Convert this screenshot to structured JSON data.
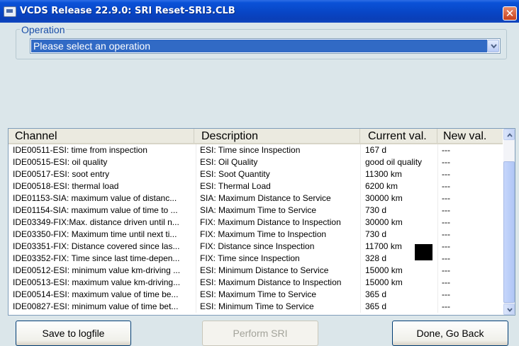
{
  "window": {
    "title": "VCDS Release 22.9.0:  SRI Reset-SRI3.CLB",
    "close_glyph": "✕"
  },
  "operation": {
    "label": "Operation",
    "selected": "Please select an operation"
  },
  "table": {
    "columns": [
      "Channel",
      "Description",
      "Current val.",
      "New val."
    ],
    "rows": [
      [
        "IDE00511-ESI: time from inspection",
        "ESI: Time since Inspection",
        "167 d",
        "---"
      ],
      [
        "IDE00515-ESI: oil quality",
        "ESI: Oil Quality",
        "good oil quality",
        "---"
      ],
      [
        "IDE00517-ESI: soot entry",
        "ESI: Soot Quantity",
        "11300 km",
        "---"
      ],
      [
        "IDE00518-ESI: thermal load",
        "ESI: Thermal Load",
        "6200 km",
        "---"
      ],
      [
        "IDE01153-SIA: maximum value of distanc...",
        "SIA: Maximum Distance to Service",
        "30000 km",
        "---"
      ],
      [
        "IDE01154-SIA: maximum value of time to ...",
        "SIA: Maximum Time to Service",
        "730 d",
        "---"
      ],
      [
        "IDE03349-FIX:Max. distance driven until n...",
        "FIX: Maximum Distance to Inspection",
        "30000 km",
        "---"
      ],
      [
        "IDE03350-FIX: Maximum time until next ti...",
        "FIX: Maximum Time to Inspection",
        "730 d",
        "---"
      ],
      [
        "IDE03351-FIX: Distance covered since las...",
        "FIX: Distance since Inspection",
        "11700 km",
        "---"
      ],
      [
        "IDE03352-FIX: Time since last time-depen...",
        "FIX: Time since Inspection",
        "328 d",
        "---"
      ],
      [
        "IDE00512-ESI: minimum value km-driving ...",
        "ESI: Minimum Distance to Service",
        "15000 km",
        "---"
      ],
      [
        "IDE00513-ESI: maximum value km-driving...",
        "ESI: Maximum Distance to Inspection",
        "15000 km",
        "---"
      ],
      [
        "IDE00514-ESI: maximum value of time be...",
        "ESI: Maximum Time to Service",
        "365 d",
        "---"
      ],
      [
        "IDE00827-ESI: minimum value of time bet...",
        "ESI: Minimum Time to Service",
        "365 d",
        "---"
      ]
    ]
  },
  "buttons": {
    "save": "Save to logfile",
    "perform": "Perform SRI",
    "done": "Done, Go Back"
  },
  "icons": {
    "app": "vcds-app-icon",
    "close": "close-icon",
    "dropdown": "chevron-down-icon",
    "scroll_up": "scroll-up-arrow-icon",
    "scroll_down": "scroll-down-arrow-icon"
  },
  "colors": {
    "titlebar": "#0845c5",
    "selection": "#316ac5",
    "legend_text": "#1b4fa8",
    "close": "#c8401c"
  }
}
